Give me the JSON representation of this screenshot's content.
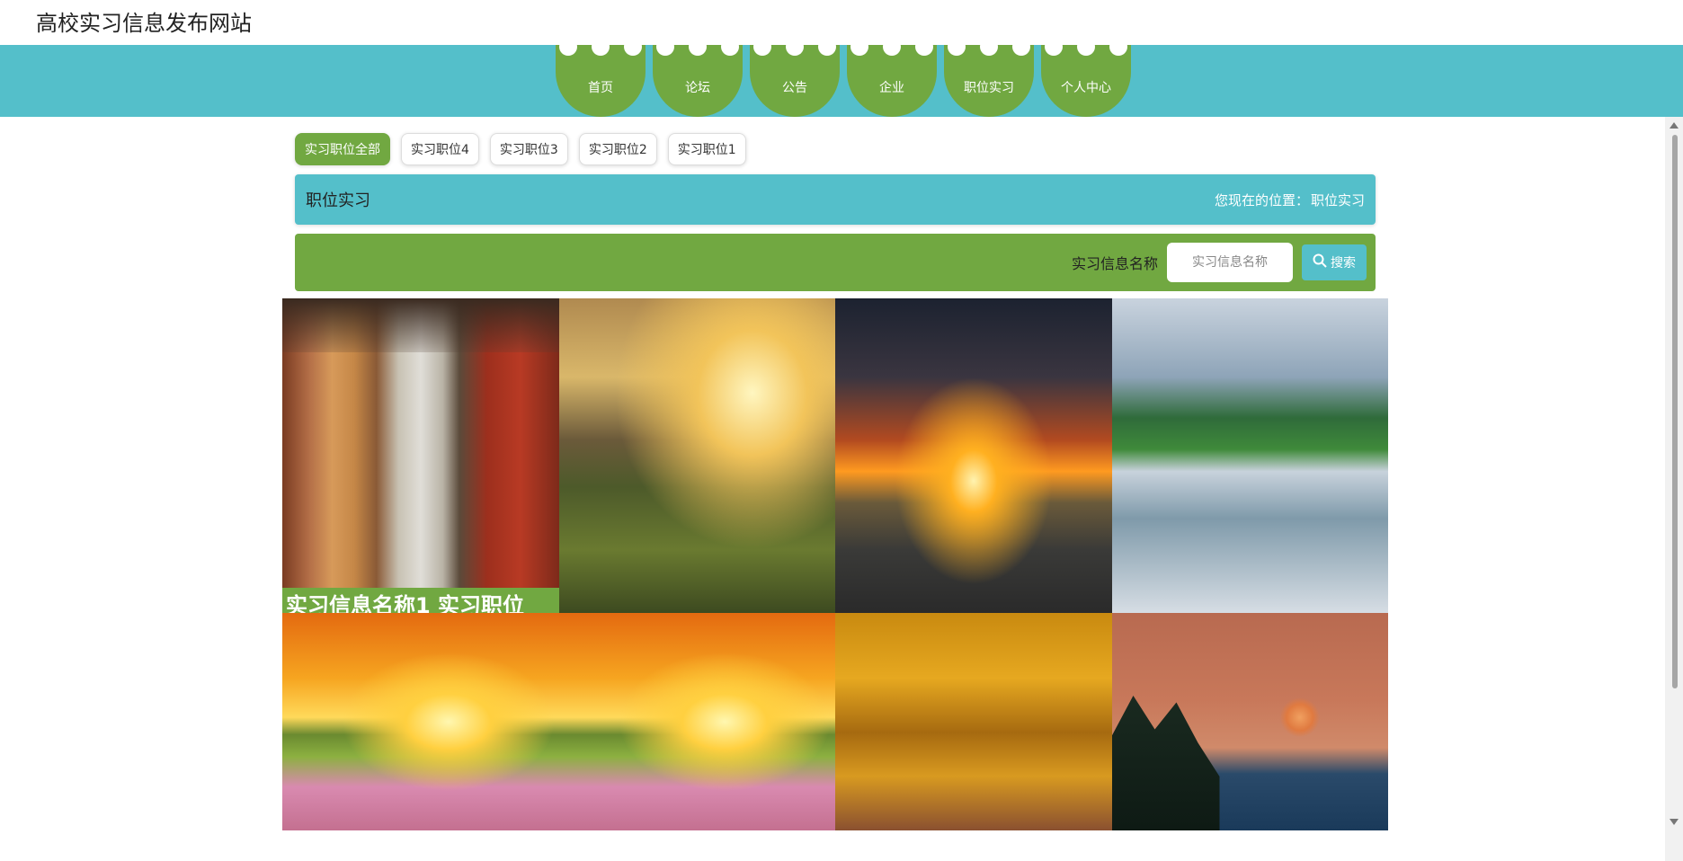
{
  "site": {
    "title": "高校实习信息发布网站"
  },
  "nav": {
    "items": [
      {
        "label": "首页",
        "icon": "home"
      },
      {
        "label": "论坛",
        "icon": "forum"
      },
      {
        "label": "公告",
        "icon": "notice"
      },
      {
        "label": "企业",
        "icon": "company"
      },
      {
        "label": "职位实习",
        "icon": "internship"
      },
      {
        "label": "个人中心",
        "icon": "user"
      }
    ]
  },
  "tabs": [
    {
      "label": "实习职位全部",
      "active": true
    },
    {
      "label": "实习职位4",
      "active": false
    },
    {
      "label": "实习职位3",
      "active": false
    },
    {
      "label": "实习职位2",
      "active": false
    },
    {
      "label": "实习职位1",
      "active": false
    }
  ],
  "breadcrumb": {
    "title": "职位实习",
    "location_prefix": "您现在的位置：",
    "location": "职位实习"
  },
  "search": {
    "label": "实习信息名称",
    "placeholder": "实习信息名称",
    "value": "",
    "button_label": "搜索",
    "button_icon": "search-icon"
  },
  "cards": [
    {
      "caption": "实习信息名称1 实习职位",
      "scene": "red-corridor"
    },
    {
      "caption": "",
      "scene": "mountain-valley"
    },
    {
      "caption": "",
      "scene": "sunset-road"
    },
    {
      "caption": "",
      "scene": "karst-lake"
    },
    {
      "caption": "",
      "scene": "sunrise-meadow"
    },
    {
      "caption": "",
      "scene": "sunrise-meadow"
    },
    {
      "caption": "",
      "scene": "autumn-trees"
    },
    {
      "caption": "",
      "scene": "moon-sunset"
    }
  ],
  "colors": {
    "teal": "#54bfca",
    "green": "#71a841",
    "white": "#ffffff"
  }
}
